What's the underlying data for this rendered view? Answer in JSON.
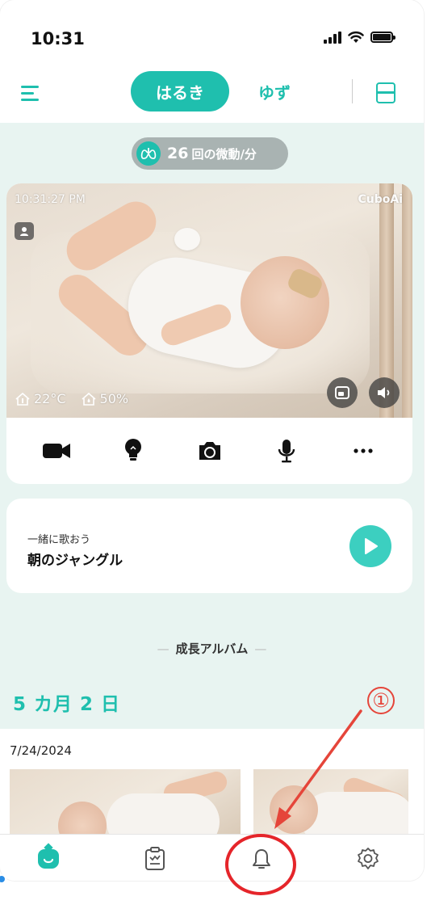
{
  "status_bar": {
    "time": "10:31"
  },
  "header": {
    "tabs": [
      {
        "label": "はるき",
        "active": true
      },
      {
        "label": "ゆず",
        "active": false
      }
    ],
    "accent_color": "#1fbfae"
  },
  "breathing": {
    "count": "26",
    "unit": "回の微動/分"
  },
  "camera": {
    "timestamp": "10:31:27 PM",
    "brand": "CuboAi",
    "temperature": "22°C",
    "humidity": "50%",
    "controls": [
      "video-camera-icon",
      "light-bulb-icon",
      "camera-icon",
      "microphone-icon",
      "more-icon"
    ]
  },
  "song": {
    "subtitle": "一緒に歌おう",
    "title": "朝のジャングル"
  },
  "album": {
    "header": "成長アルバム",
    "dash_left": "—",
    "dash_right": "—",
    "age": "5 カ月 2 日",
    "date": "7/24/2024"
  },
  "bottom_nav": {
    "items": [
      "home-icon",
      "journal-icon",
      "notification-bell-icon",
      "settings-icon"
    ],
    "active_index": 0
  },
  "annotation": {
    "label": "①",
    "color": "#e5453a"
  }
}
